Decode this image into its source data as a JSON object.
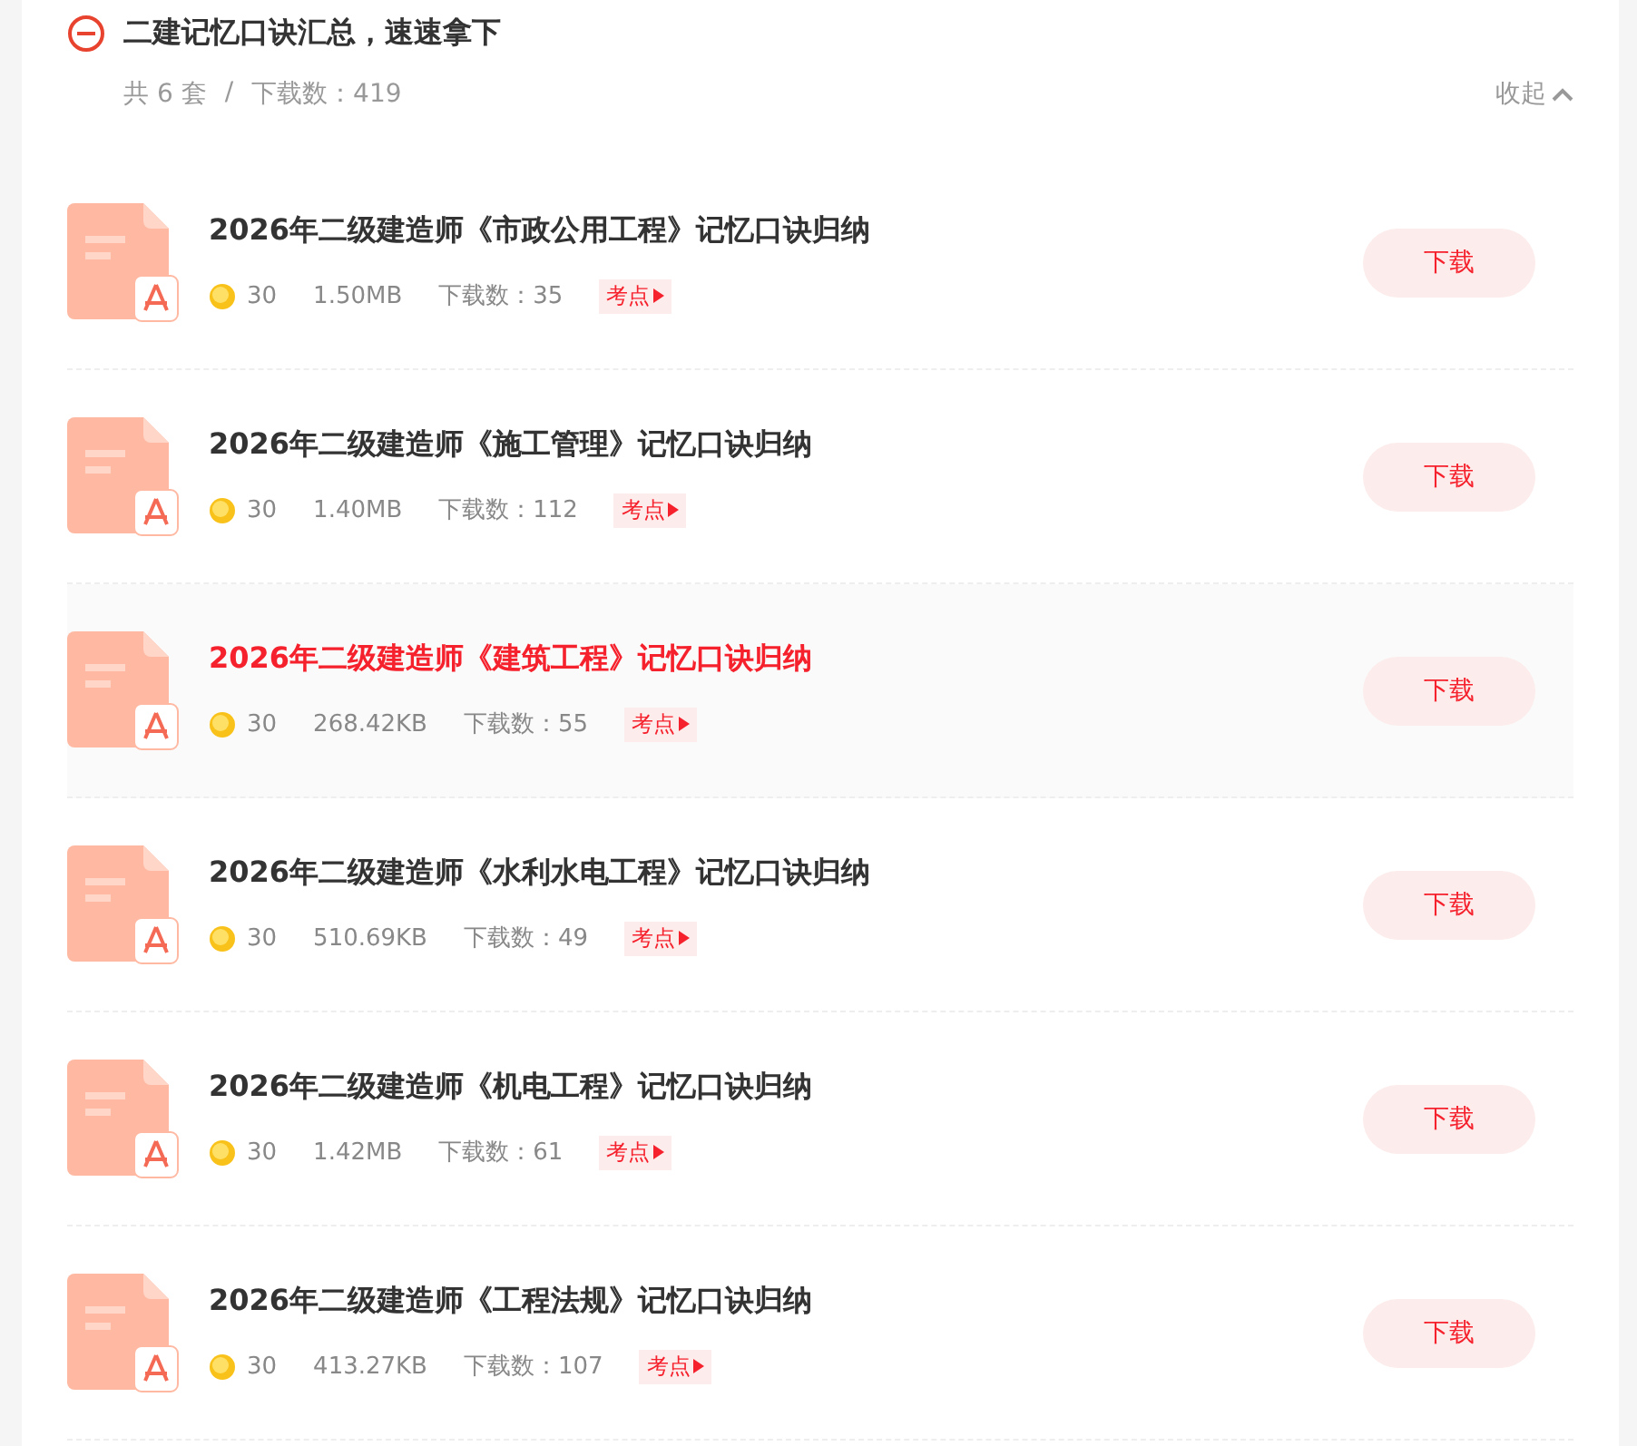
{
  "header": {
    "title": "二建记忆口诀汇总，速速拿下",
    "count": "共 6 套",
    "separator": "/",
    "downloads": "下载数：419",
    "collapse": "收起"
  },
  "files": [
    {
      "title": "2026年二级建造师《市政公用工程》记忆口诀归纳",
      "coins": "30",
      "size": "1.50MB",
      "downloads": "下载数：35",
      "tag": "考点",
      "button": "下载",
      "hovered": false
    },
    {
      "title": "2026年二级建造师《施工管理》记忆口诀归纳",
      "coins": "30",
      "size": "1.40MB",
      "downloads": "下载数：112",
      "tag": "考点",
      "button": "下载",
      "hovered": false
    },
    {
      "title": "2026年二级建造师《建筑工程》记忆口诀归纳",
      "coins": "30",
      "size": "268.42KB",
      "downloads": "下载数：55",
      "tag": "考点",
      "button": "下载",
      "hovered": true
    },
    {
      "title": "2026年二级建造师《水利水电工程》记忆口诀归纳",
      "coins": "30",
      "size": "510.69KB",
      "downloads": "下载数：49",
      "tag": "考点",
      "button": "下载",
      "hovered": false
    },
    {
      "title": "2026年二级建造师《机电工程》记忆口诀归纳",
      "coins": "30",
      "size": "1.42MB",
      "downloads": "下载数：61",
      "tag": "考点",
      "button": "下载",
      "hovered": false
    },
    {
      "title": "2026年二级建造师《工程法规》记忆口诀归纳",
      "coins": "30",
      "size": "413.27KB",
      "downloads": "下载数：107",
      "tag": "考点",
      "button": "下载",
      "hovered": false
    }
  ]
}
